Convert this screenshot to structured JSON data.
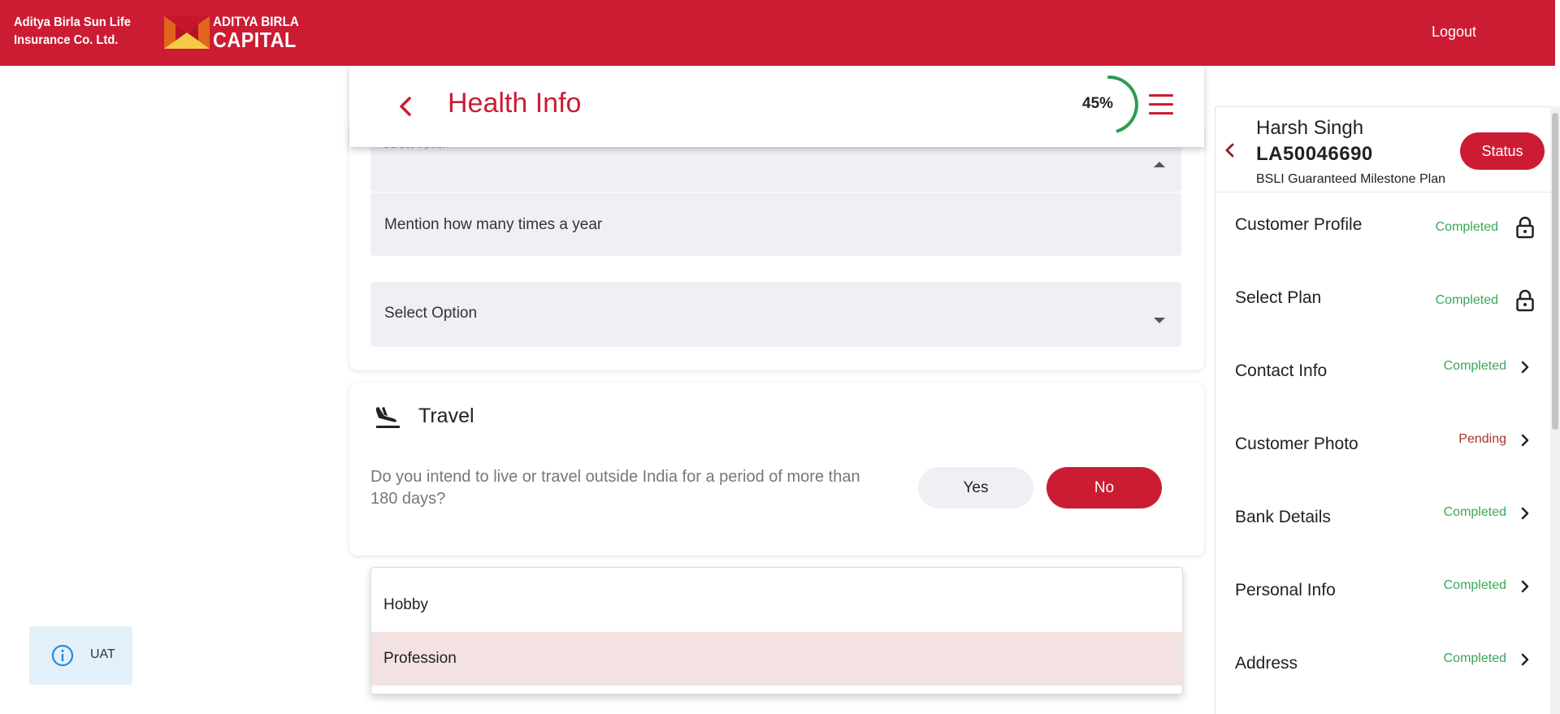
{
  "header": {
    "company_line1": "Aditya Birla Sun Life",
    "company_line2": "Insurance Co. Ltd.",
    "logo_line1": "ADITYA BIRLA",
    "logo_line2": "CAPITAL",
    "logout_label": "Logout",
    "brand_color": "#cc1c34"
  },
  "page": {
    "title": "Health Info",
    "progress_label": "45%",
    "progress_value": 45
  },
  "form": {
    "top_select_label": "Select Option",
    "times_placeholder": "Mention how many times a year",
    "select_placeholder": "Select Option"
  },
  "travel": {
    "title": "Travel",
    "question": "Do you intend to live or travel outside India for a period of more than 180 days?",
    "yes_label": "Yes",
    "no_label": "No",
    "selected": "No"
  },
  "dropdown": {
    "options": [
      "Hobby",
      "Profession"
    ],
    "highlighted": "Profession"
  },
  "env_badge": {
    "label": "UAT"
  },
  "side_panel": {
    "name": "Harsh Singh",
    "application_id": "LA50046690",
    "plan": "BSLI Guaranteed Milestone Plan",
    "status_label": "Status",
    "items": [
      {
        "label": "Customer Profile",
        "state": "Completed",
        "icon": "lock-icon"
      },
      {
        "label": "Select Plan",
        "state": "Completed",
        "icon": "lock-icon"
      },
      {
        "label": "Contact Info",
        "state": "Completed",
        "icon": "chevron-right-icon"
      },
      {
        "label": "Customer Photo",
        "state": "Pending",
        "icon": "chevron-right-icon"
      },
      {
        "label": "Bank Details",
        "state": "Completed",
        "icon": "chevron-right-icon"
      },
      {
        "label": "Personal Info",
        "state": "Completed",
        "icon": "chevron-right-icon"
      },
      {
        "label": "Address",
        "state": "Completed",
        "icon": "chevron-right-icon"
      }
    ]
  }
}
